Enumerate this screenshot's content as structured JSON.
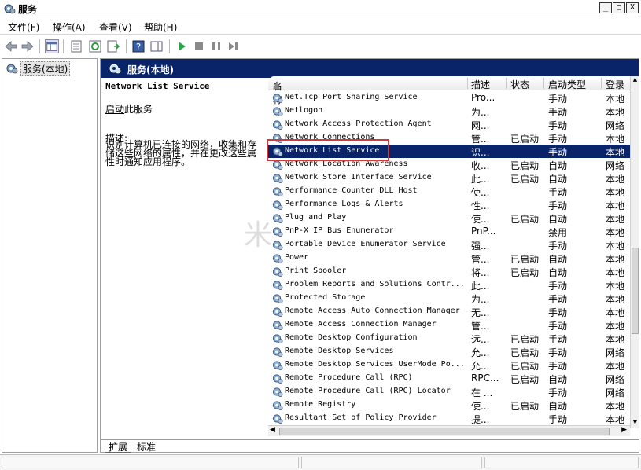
{
  "window": {
    "title": "服务",
    "min": "_",
    "max": "□",
    "close": "X"
  },
  "menu": [
    "文件(F)",
    "操作(A)",
    "查看(V)",
    "帮助(H)"
  ],
  "tree": {
    "item": "服务(本地)"
  },
  "panel": {
    "title": "服务(本地)"
  },
  "description": {
    "service_name": "Network List Service",
    "start_link": "启动",
    "start_suffix": "此服务",
    "label": "描述:",
    "text": "识别计算机已连接的网络，收集和存储这些网络的属性，并在更改这些属性时通知应用程序。"
  },
  "columns": [
    "名称",
    "描述",
    "状态",
    "启动类型",
    "登录"
  ],
  "rows": [
    {
      "name": "Net.Tcp Port Sharing Service",
      "desc": "Pro...",
      "status": "",
      "startup": "手动",
      "logon": "本地"
    },
    {
      "name": "Netlogon",
      "desc": "为...",
      "status": "",
      "startup": "手动",
      "logon": "本地"
    },
    {
      "name": "Network Access Protection Agent",
      "desc": "网...",
      "status": "",
      "startup": "手动",
      "logon": "网络"
    },
    {
      "name": "Network Connections",
      "desc": "管...",
      "status": "已启动",
      "startup": "手动",
      "logon": "本地"
    },
    {
      "name": "Network List Service",
      "desc": "识...",
      "status": "",
      "startup": "手动",
      "logon": "本地"
    },
    {
      "name": "Network Location Awareness",
      "desc": "收...",
      "status": "已启动",
      "startup": "自动",
      "logon": "网络"
    },
    {
      "name": "Network Store Interface Service",
      "desc": "此...",
      "status": "已启动",
      "startup": "自动",
      "logon": "本地"
    },
    {
      "name": "Performance Counter DLL Host",
      "desc": "使...",
      "status": "",
      "startup": "手动",
      "logon": "本地"
    },
    {
      "name": "Performance Logs & Alerts",
      "desc": "性...",
      "status": "",
      "startup": "手动",
      "logon": "本地"
    },
    {
      "name": "Plug and Play",
      "desc": "使...",
      "status": "已启动",
      "startup": "自动",
      "logon": "本地"
    },
    {
      "name": "PnP-X IP Bus Enumerator",
      "desc": "PnP...",
      "status": "",
      "startup": "禁用",
      "logon": "本地"
    },
    {
      "name": "Portable Device Enumerator Service",
      "desc": "强...",
      "status": "",
      "startup": "手动",
      "logon": "本地"
    },
    {
      "name": "Power",
      "desc": "管...",
      "status": "已启动",
      "startup": "自动",
      "logon": "本地"
    },
    {
      "name": "Print Spooler",
      "desc": "将...",
      "status": "已启动",
      "startup": "自动",
      "logon": "本地"
    },
    {
      "name": "Problem Reports and Solutions Contr...",
      "desc": "此...",
      "status": "",
      "startup": "手动",
      "logon": "本地"
    },
    {
      "name": "Protected Storage",
      "desc": "为...",
      "status": "",
      "startup": "手动",
      "logon": "本地"
    },
    {
      "name": "Remote Access Auto Connection Manager",
      "desc": "无...",
      "status": "",
      "startup": "手动",
      "logon": "本地"
    },
    {
      "name": "Remote Access Connection Manager",
      "desc": "管...",
      "status": "",
      "startup": "手动",
      "logon": "本地"
    },
    {
      "name": "Remote Desktop Configuration",
      "desc": "远...",
      "status": "已启动",
      "startup": "手动",
      "logon": "本地"
    },
    {
      "name": "Remote Desktop Services",
      "desc": "允...",
      "status": "已启动",
      "startup": "手动",
      "logon": "网络"
    },
    {
      "name": "Remote Desktop Services UserMode Po...",
      "desc": "允...",
      "status": "已启动",
      "startup": "手动",
      "logon": "本地"
    },
    {
      "name": "Remote Procedure Call (RPC)",
      "desc": "RPC...",
      "status": "已启动",
      "startup": "自动",
      "logon": "网络"
    },
    {
      "name": "Remote Procedure Call (RPC) Locator",
      "desc": "在 ...",
      "status": "",
      "startup": "手动",
      "logon": "网络"
    },
    {
      "name": "Remote Registry",
      "desc": "使...",
      "status": "已启动",
      "startup": "自动",
      "logon": "本地"
    },
    {
      "name": "Resultant Set of Policy Provider",
      "desc": "提...",
      "status": "",
      "startup": "手动",
      "logon": "本地"
    }
  ],
  "selected_row": 4,
  "tabs": [
    "扩展",
    "标准"
  ],
  "watermark": "米",
  "colors": {
    "selection": "#0a246a",
    "highlight_box": "#d23a3a"
  }
}
